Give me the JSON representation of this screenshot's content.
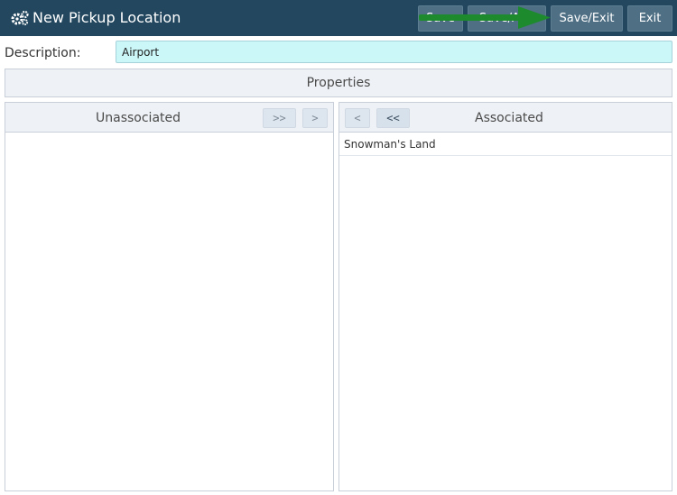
{
  "header": {
    "title": "New Pickup Location",
    "title_icon": "gears-icon",
    "buttons": {
      "save": "Save",
      "save_add": "Save/Add",
      "save_exit": "Save/Exit",
      "exit": "Exit"
    }
  },
  "form": {
    "description_label": "Description:",
    "description_value": "Airport",
    "properties_label": "Properties"
  },
  "unassociated": {
    "title": "Unassociated",
    "move_all_right": ">>",
    "move_right": ">",
    "items": []
  },
  "associated": {
    "title": "Associated",
    "move_left": "<",
    "move_all_left": "<<",
    "items": [
      "Snowman's Land"
    ]
  },
  "colors": {
    "header_bg": "#22475e",
    "input_bg": "#ccf7f8",
    "annotation_arrow": "#1e8a2e"
  }
}
